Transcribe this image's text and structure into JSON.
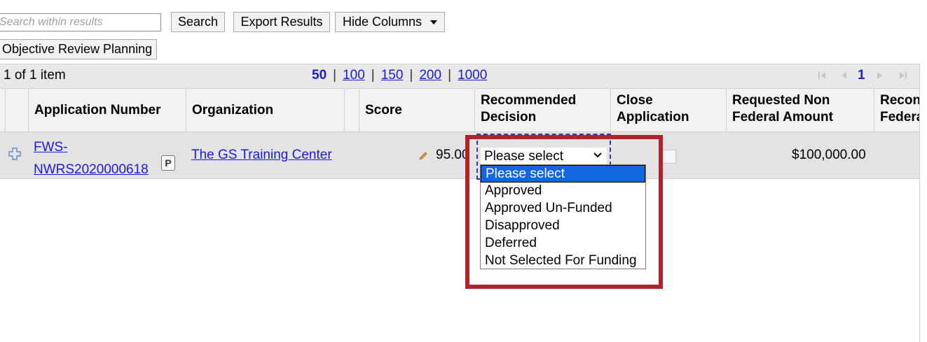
{
  "toolbar": {
    "search_placeholder": "Search within results",
    "search_button": "Search",
    "export_button": "Export Results",
    "hide_columns_button": "Hide Columns",
    "objective_button": "Objective Review Planning"
  },
  "pager": {
    "item_count": "1 of 1 item",
    "page_sizes": [
      "50",
      "100",
      "150",
      "200",
      "1000"
    ],
    "active_page_size": "50",
    "current_page": "1"
  },
  "table": {
    "columns": {
      "application_number": "Application Number",
      "organization": "Organization",
      "score": "Score",
      "recommended_decision_1": "Recommended",
      "recommended_decision_2": "Decision",
      "close_application_1": "Close",
      "close_application_2": "Application",
      "requested_non_federal_1": "Requested Non",
      "requested_non_federal_2": "Federal Amount",
      "truncated_1": "Recon",
      "truncated_2": "Federa"
    },
    "row": {
      "application_number_1": "FWS-",
      "application_number_2": "NWRS2020000618",
      "p_badge": "P",
      "organization": "The GS Training Center",
      "score": "95.00",
      "decision_selected": "Please select",
      "requested_non_federal_amount": "$100,000.00"
    }
  },
  "decision_options": [
    "Please select",
    "Approved",
    "Approved Un-Funded",
    "Disapproved",
    "Deferred",
    "Not Selected For Funding"
  ],
  "colors": {
    "link": "#1a1ad6",
    "highlight": "#b0232d",
    "selected_option": "#1266e0"
  }
}
